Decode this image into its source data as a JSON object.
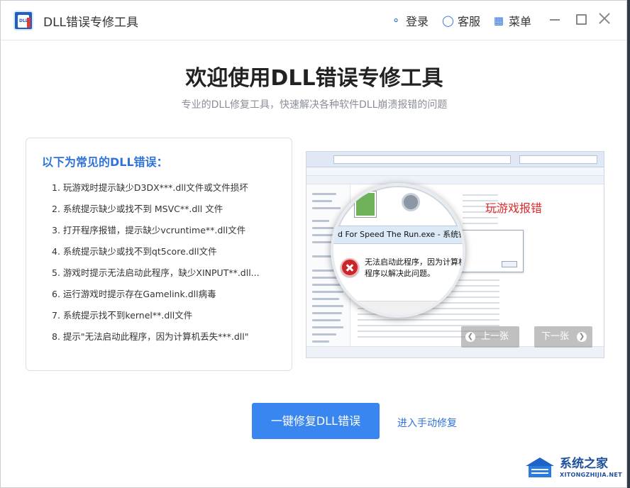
{
  "titlebar": {
    "app_title": "DLL错误专修工具",
    "login_label": "登录",
    "service_label": "客服",
    "menu_label": "菜单"
  },
  "hero": {
    "title": "欢迎使用DLL错误专修工具",
    "subtitle": "专业的DLL修复工具，快速解决各种软件DLL崩溃报错的问题"
  },
  "errors": {
    "heading": "以下为常见的DLL错误：",
    "items": [
      "1. 玩游戏时提示缺少D3DX***.dll文件或文件损坏",
      "2. 系统提示缺少或找不到 MSVC**.dll 文件",
      "3. 打开程序报错，提示缺少vcruntime**.dll文件",
      "4. 系统提示缺少或找不到qt5core.dll文件",
      "5. 游戏时提示无法启动此程序，缺少XINPUT**.dll...",
      "6. 运行游戏时提示存在Gamelink.dll病毒",
      "7. 系统提示找不到kernel**.dll文件",
      "8. 提示\"无法启动此程序，因为计算机丢失***.dll\""
    ]
  },
  "preview": {
    "caption": "玩游戏报错",
    "dialog_title": "d For Speed The Run.exe - 系统错误",
    "dialog_msg_line1": "无法启动此程序，因为计算机中",
    "dialog_msg_line2": "程序以解决此问题。",
    "prev_label": "上一张",
    "next_label": "下一张"
  },
  "actions": {
    "repair_button": "一键修复DLL错误",
    "manual_link": "进入手动修复"
  },
  "watermark": {
    "brand": "系统之家",
    "url": "XITONGZHIJIA.NET"
  },
  "colors": {
    "accent": "#3a86f0",
    "link": "#2f73d8",
    "caption_red": "#e02b2b"
  }
}
